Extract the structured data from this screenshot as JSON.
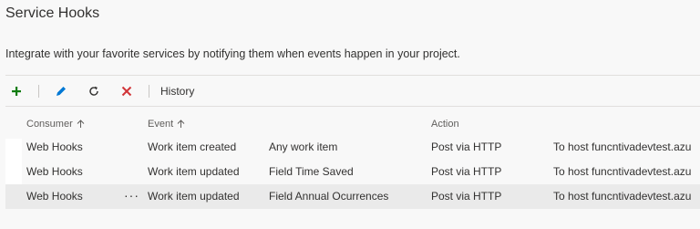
{
  "page": {
    "title": "Service Hooks",
    "description": "Integrate with your favorite services by notifying them when events happen in your project."
  },
  "toolbar": {
    "history_label": "History",
    "colors": {
      "add": "#107c10",
      "edit": "#0078d4",
      "refresh": "#323130",
      "delete": "#d13438"
    }
  },
  "table": {
    "headers": {
      "consumer": "Consumer",
      "event": "Event",
      "action": "Action"
    },
    "more_label": "···",
    "rows": [
      {
        "consumer": "Web Hooks",
        "event": "Work item created",
        "filter": "Any work item",
        "action": "Post via HTTP",
        "target": "To host funcntivadevtest.azu"
      },
      {
        "consumer": "Web Hooks",
        "event": "Work item updated",
        "filter": "Field Time Saved",
        "action": "Post via HTTP",
        "target": "To host funcntivadevtest.azu"
      },
      {
        "consumer": "Web Hooks",
        "event": "Work item updated",
        "filter": "Field Annual Ocurrences",
        "action": "Post via HTTP",
        "target": "To host funcntivadevtest.azu"
      }
    ]
  }
}
